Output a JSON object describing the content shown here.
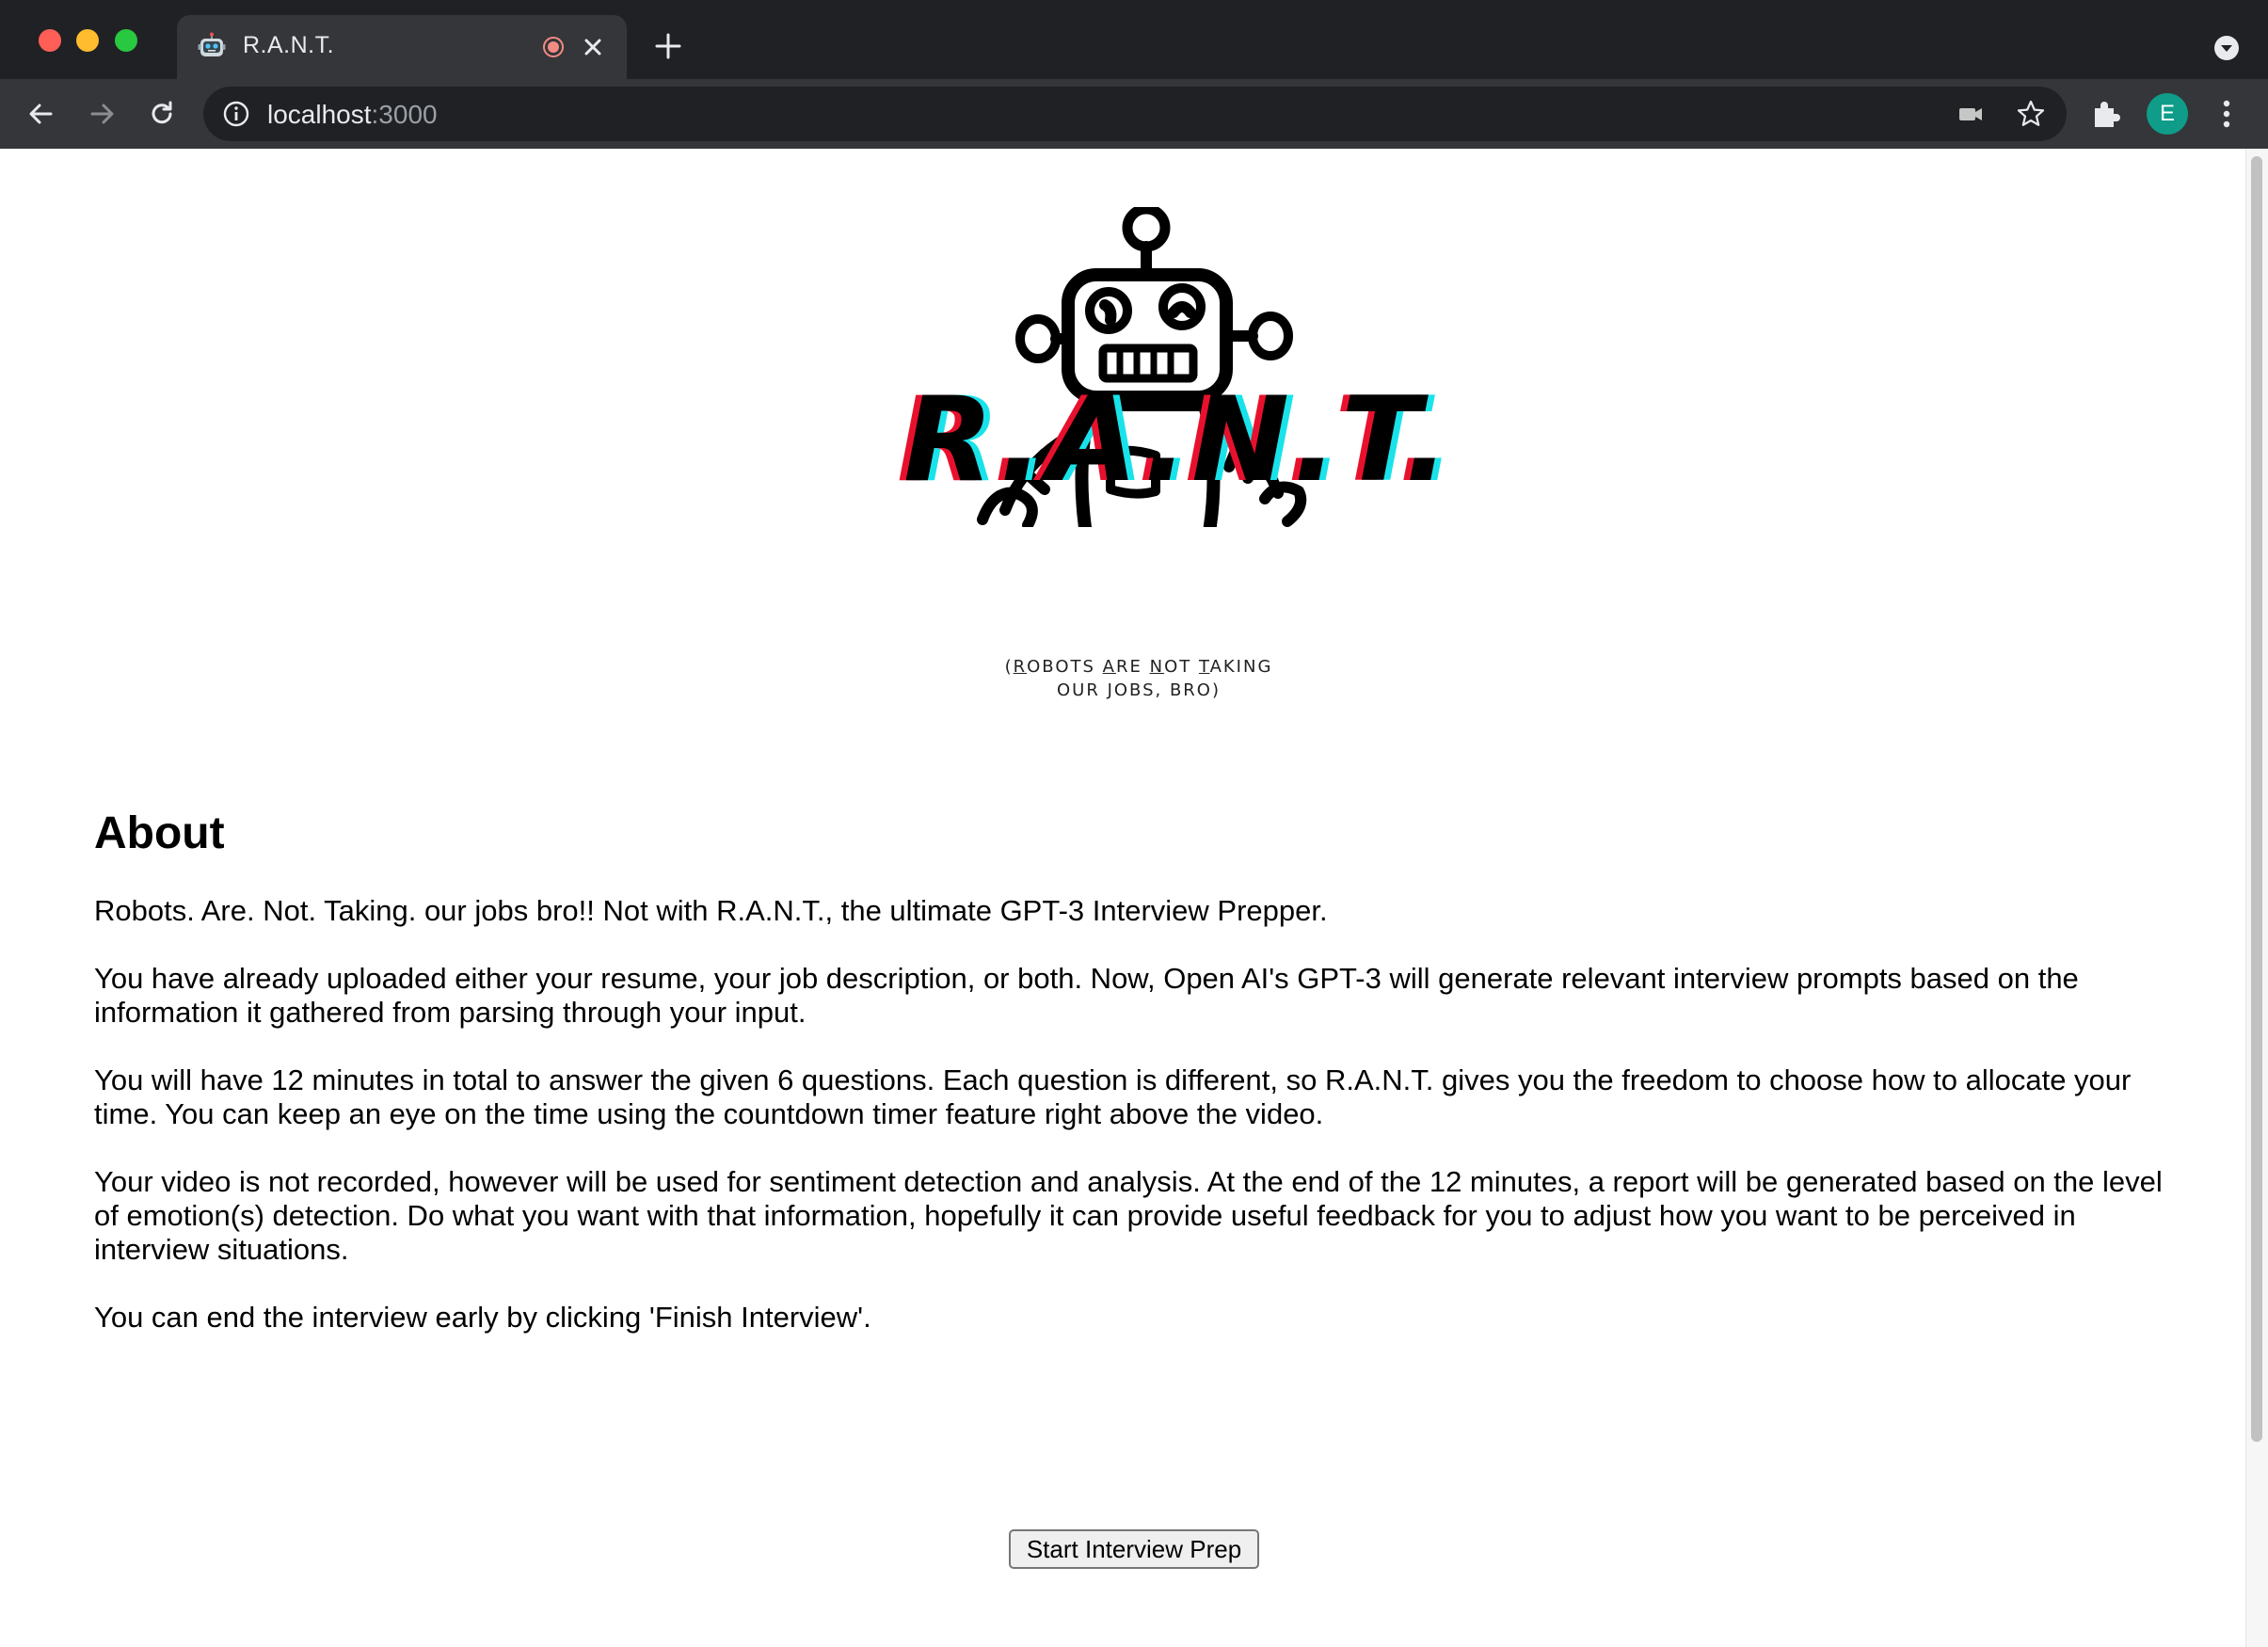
{
  "browser": {
    "tab": {
      "title": "R.A.N.T.",
      "favicon": "robot-emoji-icon",
      "recording_color": "#f28b82"
    },
    "address_bar": {
      "host": "localhost",
      "port": ":3000"
    },
    "profile_initial": "E",
    "profile_color": "#0f9d8a",
    "tab_bar_color": "#202124",
    "toolbar_color": "#35363a"
  },
  "logo": {
    "text": "R.A.N.T.",
    "shadow_colors": [
      "#e8112d",
      "#19e3ea"
    ],
    "tagline": {
      "open_paren": "(",
      "r": "R",
      "r_rest": "OBOTS ",
      "a": "A",
      "a_rest": "RE ",
      "n": "N",
      "n_rest": "OT ",
      "t": "T",
      "t_rest": "AKING",
      "line2": "OUR JOBS, BRO)"
    }
  },
  "about": {
    "heading": "About",
    "paragraphs": [
      "Robots. Are. Not. Taking. our jobs bro!! Not with R.A.N.T., the ultimate GPT-3 Interview Prepper.",
      "You have already uploaded either your resume, your job description, or both. Now, Open AI's GPT-3 will generate relevant interview prompts based on the information it gathered from parsing through your input.",
      "You will have 12 minutes in total to answer the given 6 questions. Each question is different, so R.A.N.T. gives you the freedom to choose how to allocate your time. You can keep an eye on the time using the countdown timer feature right above the video.",
      "Your video is not recorded, however will be used for sentiment detection and analysis. At the end of the 12 minutes, a report will be generated based on the level of emotion(s) detection. Do what you want with that information, hopefully it can provide useful feedback for you to adjust how you want to be perceived in interview situations.",
      "You can end the interview early by clicking 'Finish Interview'."
    ]
  },
  "start_button": {
    "label": "Start Interview Prep"
  }
}
